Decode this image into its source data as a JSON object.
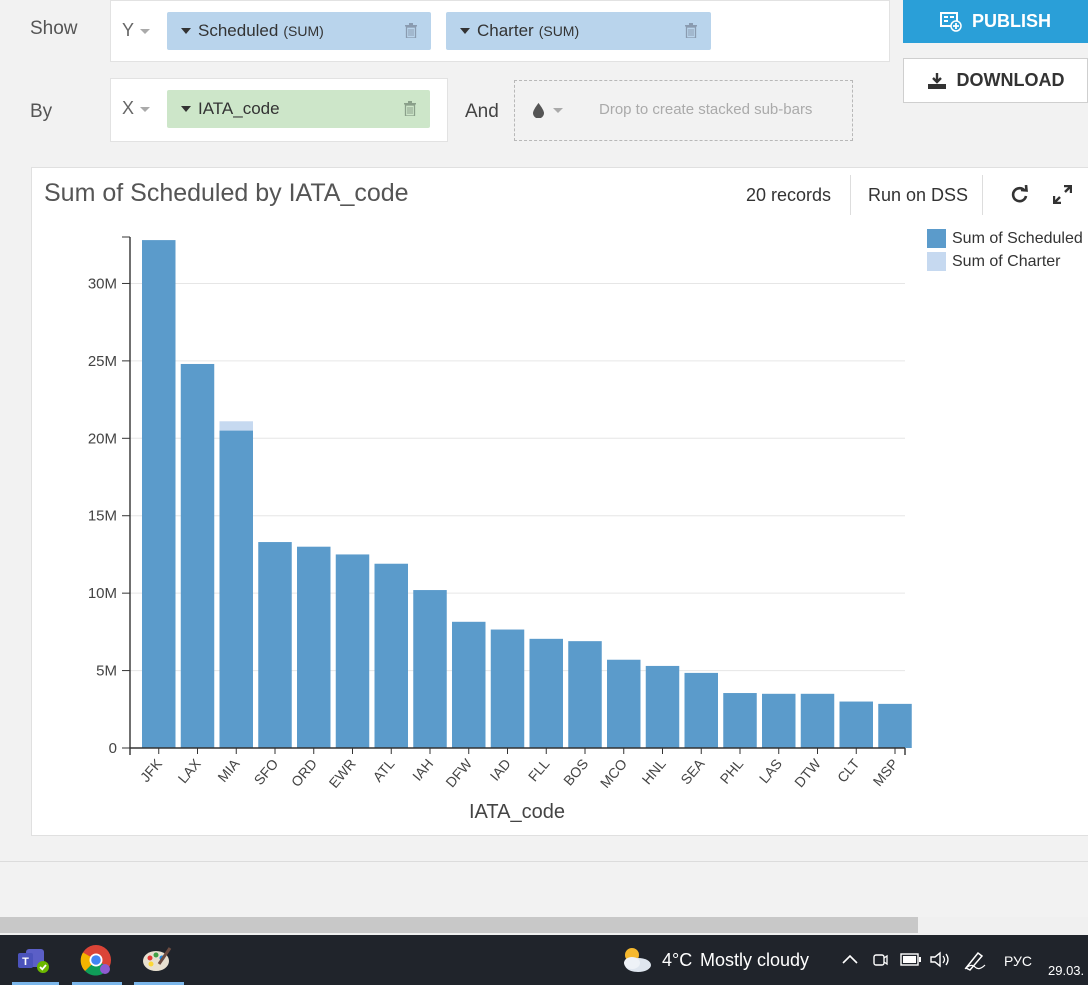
{
  "toolbar": {
    "show_label": "Show",
    "by_label": "By",
    "and_label": "And",
    "y_axis": "Y",
    "x_axis": "X",
    "y_fields": [
      {
        "name": "Scheduled",
        "agg": "(SUM)"
      },
      {
        "name": "Charter",
        "agg": "(SUM)"
      }
    ],
    "x_field": {
      "name": "IATA_code"
    },
    "drop_placeholder": "Drop to create stacked sub-bars",
    "publish_label": "PUBLISH",
    "download_label": "DOWNLOAD"
  },
  "chart_header": {
    "title": "Sum of Scheduled by IATA_code",
    "records": "20 records",
    "run_label": "Run on DSS"
  },
  "colors": {
    "scheduled": "#5b9bcb",
    "charter": "#c6d9f0",
    "publish_bg": "#2a9fd8",
    "y_pill": "#b9d4ec",
    "x_pill": "#cde6c9",
    "taskbar": "#20242b"
  },
  "chart_data": {
    "type": "bar",
    "stacked": true,
    "categories": [
      "JFK",
      "LAX",
      "MIA",
      "SFO",
      "ORD",
      "EWR",
      "ATL",
      "IAH",
      "DFW",
      "IAD",
      "FLL",
      "BOS",
      "MCO",
      "HNL",
      "SEA",
      "PHL",
      "LAS",
      "DTW",
      "CLT",
      "MSP"
    ],
    "series": [
      {
        "name": "Sum of Scheduled",
        "values": [
          32800000,
          24800000,
          20500000,
          13300000,
          13000000,
          12500000,
          11900000,
          10200000,
          8150000,
          7650000,
          7050000,
          6900000,
          5700000,
          5300000,
          4850000,
          3550000,
          3500000,
          3500000,
          3000000,
          2850000
        ]
      },
      {
        "name": "Sum of Charter",
        "values": [
          0,
          0,
          600000,
          0,
          0,
          0,
          0,
          0,
          0,
          0,
          0,
          0,
          0,
          0,
          0,
          0,
          0,
          0,
          0,
          0
        ]
      }
    ],
    "xlabel": "IATA_code",
    "ylabel": "",
    "ylim": [
      0,
      33000000
    ],
    "yticks": [
      0,
      5000000,
      10000000,
      15000000,
      20000000,
      25000000,
      30000000
    ],
    "ytick_labels": [
      "0",
      "5M",
      "10M",
      "15M",
      "20M",
      "25M",
      "30M"
    ],
    "grid": true,
    "legend": "top-right"
  },
  "taskbar": {
    "weather_temp": "4°C",
    "weather_text": "Mostly cloudy",
    "language": "РУС",
    "date": "29.03."
  }
}
